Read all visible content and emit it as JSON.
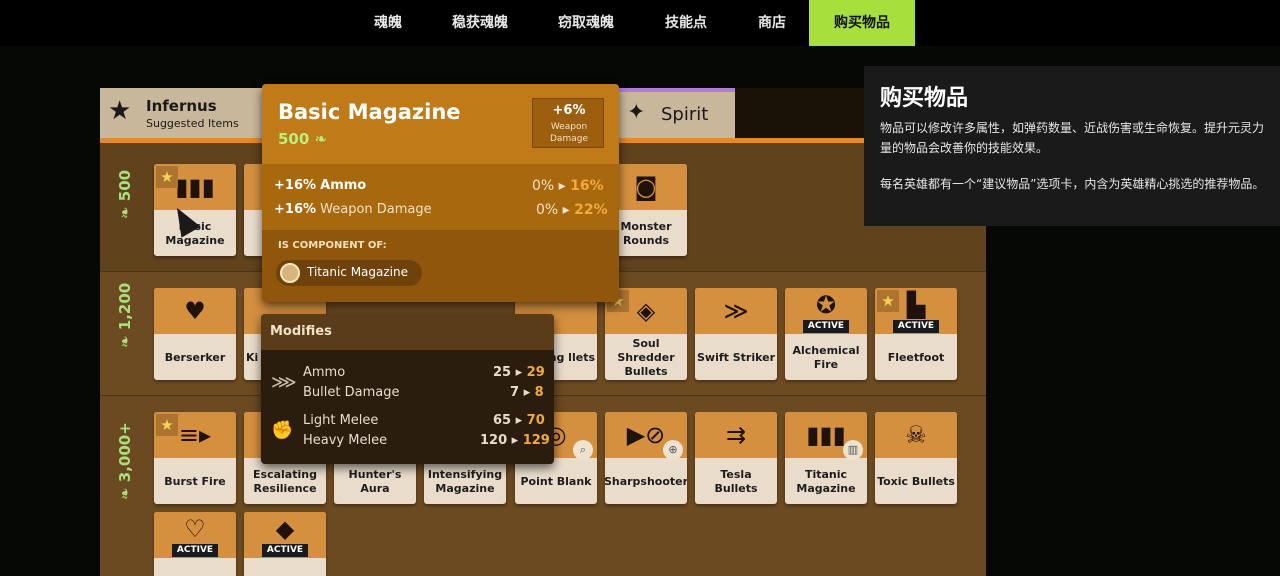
{
  "nav": {
    "tabs": [
      {
        "label": "魂魄"
      },
      {
        "label": "稳获魂魄"
      },
      {
        "label": "窃取魂魄"
      },
      {
        "label": "技能点"
      },
      {
        "label": "商店"
      },
      {
        "label": "购买物品"
      }
    ],
    "active_index": 5
  },
  "categories": {
    "infernus": {
      "title": "Infernus",
      "subtitle": "Suggested Items"
    },
    "spirit": {
      "label": "Spirit",
      "icon": "sparkle-icon"
    }
  },
  "tiers": [
    {
      "label": "500"
    },
    {
      "label": "1,200"
    },
    {
      "label": "3,000+"
    }
  ],
  "items": {
    "t1": [
      {
        "name": "Basic Magazine",
        "icon": "magazine-icon",
        "star": true
      },
      {
        "name": "Monster Rounds",
        "icon": "robot-icon"
      }
    ],
    "t2": [
      {
        "name": "Berserker",
        "icon": "berserker-icon"
      },
      {
        "name": "Ki",
        "icon": "ki-icon"
      },
      {
        "name": "wing llets",
        "icon": "wing-icon"
      },
      {
        "name": "Soul Shredder Bullets",
        "icon": "shredder-icon",
        "star": true
      },
      {
        "name": "Swift Striker",
        "icon": "striker-icon"
      },
      {
        "name": "Alchemical Fire",
        "icon": "fire-icon",
        "active_label": "ACTIVE"
      },
      {
        "name": "Fleetfoot",
        "icon": "boot-icon",
        "star": true,
        "active_label": "ACTIVE"
      }
    ],
    "t3": [
      {
        "name": "Burst Fire",
        "icon": "burst-icon",
        "star": true
      },
      {
        "name": "Escalating Resilience",
        "icon": "resilience-icon"
      },
      {
        "name": "Hunter's Aura",
        "icon": "aura-icon"
      },
      {
        "name": "Intensifying Magazine",
        "icon": "intensify-icon"
      },
      {
        "name": "Point Blank",
        "icon": "target-icon"
      },
      {
        "name": "Sharpshooter",
        "icon": "sharpshooter-icon"
      },
      {
        "name": "Tesla Bullets",
        "icon": "tesla-icon"
      },
      {
        "name": "Titanic Magazine",
        "icon": "titanic-icon"
      },
      {
        "name": "Toxic Bullets",
        "icon": "toxic-icon"
      },
      {
        "name": "",
        "icon": "heart-icon",
        "active_label": "ACTIVE"
      },
      {
        "name": "",
        "icon": "crystal-icon",
        "active_label": "ACTIVE"
      }
    ]
  },
  "tooltip": {
    "title": "Basic Magazine",
    "cost": "500",
    "box_value": "+6%",
    "box_label": "Weapon Damage",
    "stat1_pct": "+16%",
    "stat1_name": "Ammo",
    "stat1_from": "0%",
    "stat1_to": "16%",
    "stat2_pct": "+16%",
    "stat2_name": "Weapon Damage",
    "stat2_from": "0%",
    "stat2_to": "22%",
    "component_label": "IS COMPONENT OF:",
    "component_item": "Titanic Magazine"
  },
  "modifies": {
    "title": "Modifies",
    "rows": [
      {
        "label": "Ammo",
        "from": "25",
        "to": "29"
      },
      {
        "label": "Bullet Damage",
        "from": "7",
        "to": "8"
      },
      {
        "label": "Light Melee",
        "from": "65",
        "to": "70"
      },
      {
        "label": "Heavy Melee",
        "from": "120",
        "to": "129"
      }
    ]
  },
  "info": {
    "title": "购买物品",
    "p1": "物品可以修改许多属性，如弹药数量、近战伤害或生命恢复。提升元灵力量的物品会改善你的技能效果。",
    "p2": "每名英雄都有一个“建议物品”选项卡，内含为英雄精心挑选的推荐物品。"
  }
}
